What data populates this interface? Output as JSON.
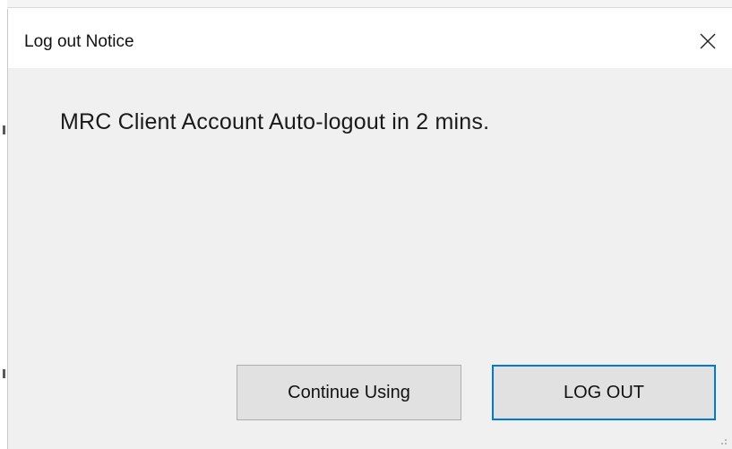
{
  "dialog": {
    "title": "Log out Notice",
    "message": "MRC Client Account Auto-logout in 2 mins.",
    "close_icon": "close-icon",
    "buttons": {
      "continue_label": "Continue Using",
      "logout_label": "LOG OUT"
    }
  },
  "colors": {
    "dialog_bg": "#f0f0f0",
    "titlebar_bg": "#ffffff",
    "button_bg": "#e1e1e1",
    "focus_border": "#0078d7"
  }
}
